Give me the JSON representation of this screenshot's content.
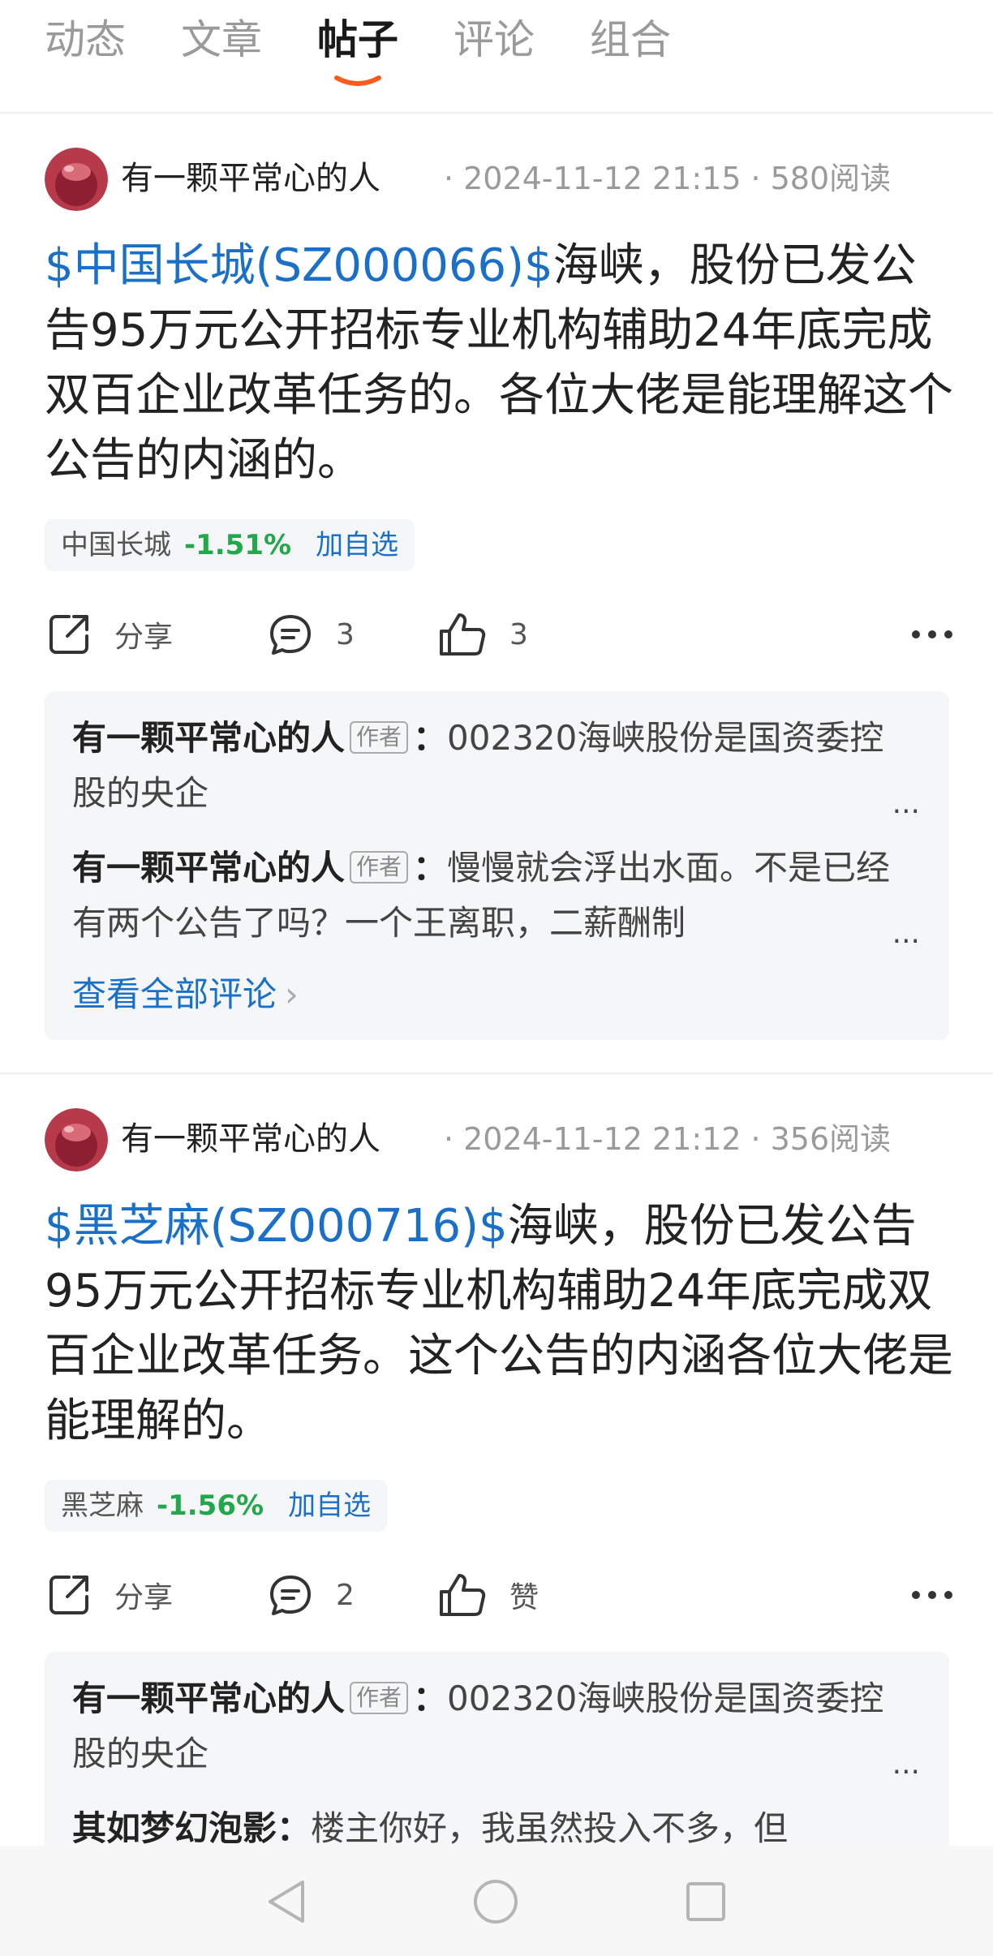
{
  "tabs": [
    {
      "label": "动态",
      "active": false
    },
    {
      "label": "文章",
      "active": false
    },
    {
      "label": "帖子",
      "active": true
    },
    {
      "label": "评论",
      "active": false
    },
    {
      "label": "组合",
      "active": false
    }
  ],
  "posts": [
    {
      "author": "有一颗平常心的人",
      "date": "2024-11-12 21:15",
      "reads": "580阅读",
      "tag": "$中国长城(SZ000066)$",
      "text_line1": "海峡，股份已发公告",
      "text_rest": "95万元公开招标专业机构辅助24年底完成双百企业改革任务的。各位大佬是能理解这个公告的内涵的。",
      "quote": {
        "name": "中国长城",
        "change": "-1.51%",
        "add": "加自选"
      },
      "actions": {
        "share": "分享",
        "comments": "3",
        "likes": "3"
      },
      "comments": [
        {
          "name": "有一颗平常心的人",
          "badge": "作者",
          "text": "002320海峡股份是国资委控股的央企"
        },
        {
          "name": "有一颗平常心的人",
          "badge": "作者",
          "text": "慢慢就会浮出水面。不是已经有两个公告了吗？一个王离职，二薪酬制"
        }
      ],
      "view_all": "查看全部评论"
    },
    {
      "author": "有一颗平常心的人",
      "date": "2024-11-12 21:12",
      "reads": "356阅读",
      "tag": "$黑芝麻(SZ000716)$",
      "text_line1": "海峡，股份已发公告9",
      "text_rest": "5万元公开招标专业机构辅助24年底完成双百企业改革任务。这个公告的内涵各位大佬是能理解的。",
      "quote": {
        "name": "黑芝麻",
        "change": "-1.56%",
        "add": "加自选"
      },
      "actions": {
        "share": "分享",
        "comments": "2",
        "likes": "赞"
      },
      "comments": [
        {
          "name": "有一颗平常心的人",
          "badge": "作者",
          "text": "002320海峡股份是国资委控股的央企"
        },
        {
          "name": "其如梦幻泡影",
          "badge": "",
          "text": "楼主你好，我虽然投入不多，但"
        }
      ]
    }
  ],
  "ellipsis": "...",
  "colors": {
    "link": "#1a6fc9",
    "down": "#22a84a",
    "underline": "#ff5a1f"
  },
  "navbar": {
    "back": "back-triangle-icon",
    "home": "home-circle-icon",
    "recents": "recents-square-icon"
  }
}
